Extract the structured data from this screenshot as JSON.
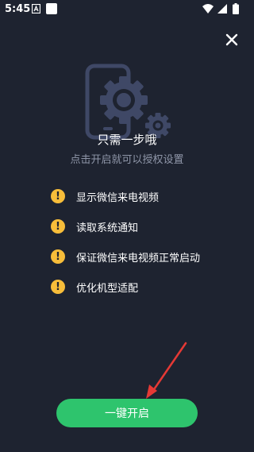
{
  "status_bar": {
    "time": "5:45",
    "icons": [
      "notification-a-icon",
      "notification-square-icon",
      "wifi-icon",
      "signal-icon",
      "battery-icon"
    ]
  },
  "close_icon": "close-icon",
  "hero_icon": "phone-gear-icon",
  "title": "只需一步哦",
  "subtitle": "点击开启就可以授权设置",
  "permissions": [
    {
      "icon": "warning-icon",
      "glyph": "!",
      "label": "显示微信来电视频"
    },
    {
      "icon": "warning-icon",
      "glyph": "!",
      "label": "读取系统通知"
    },
    {
      "icon": "warning-icon",
      "glyph": "!",
      "label": "保证微信来电视频正常启动"
    },
    {
      "icon": "warning-icon",
      "glyph": "!",
      "label": "优化机型适配"
    }
  ],
  "enable_button_label": "一键开启",
  "colors": {
    "background": "#1e2330",
    "accent_green": "#2ec46d",
    "warning_yellow": "#f7bd3a",
    "arrow_red": "#e53935",
    "hero_icon": "#3f4866"
  }
}
